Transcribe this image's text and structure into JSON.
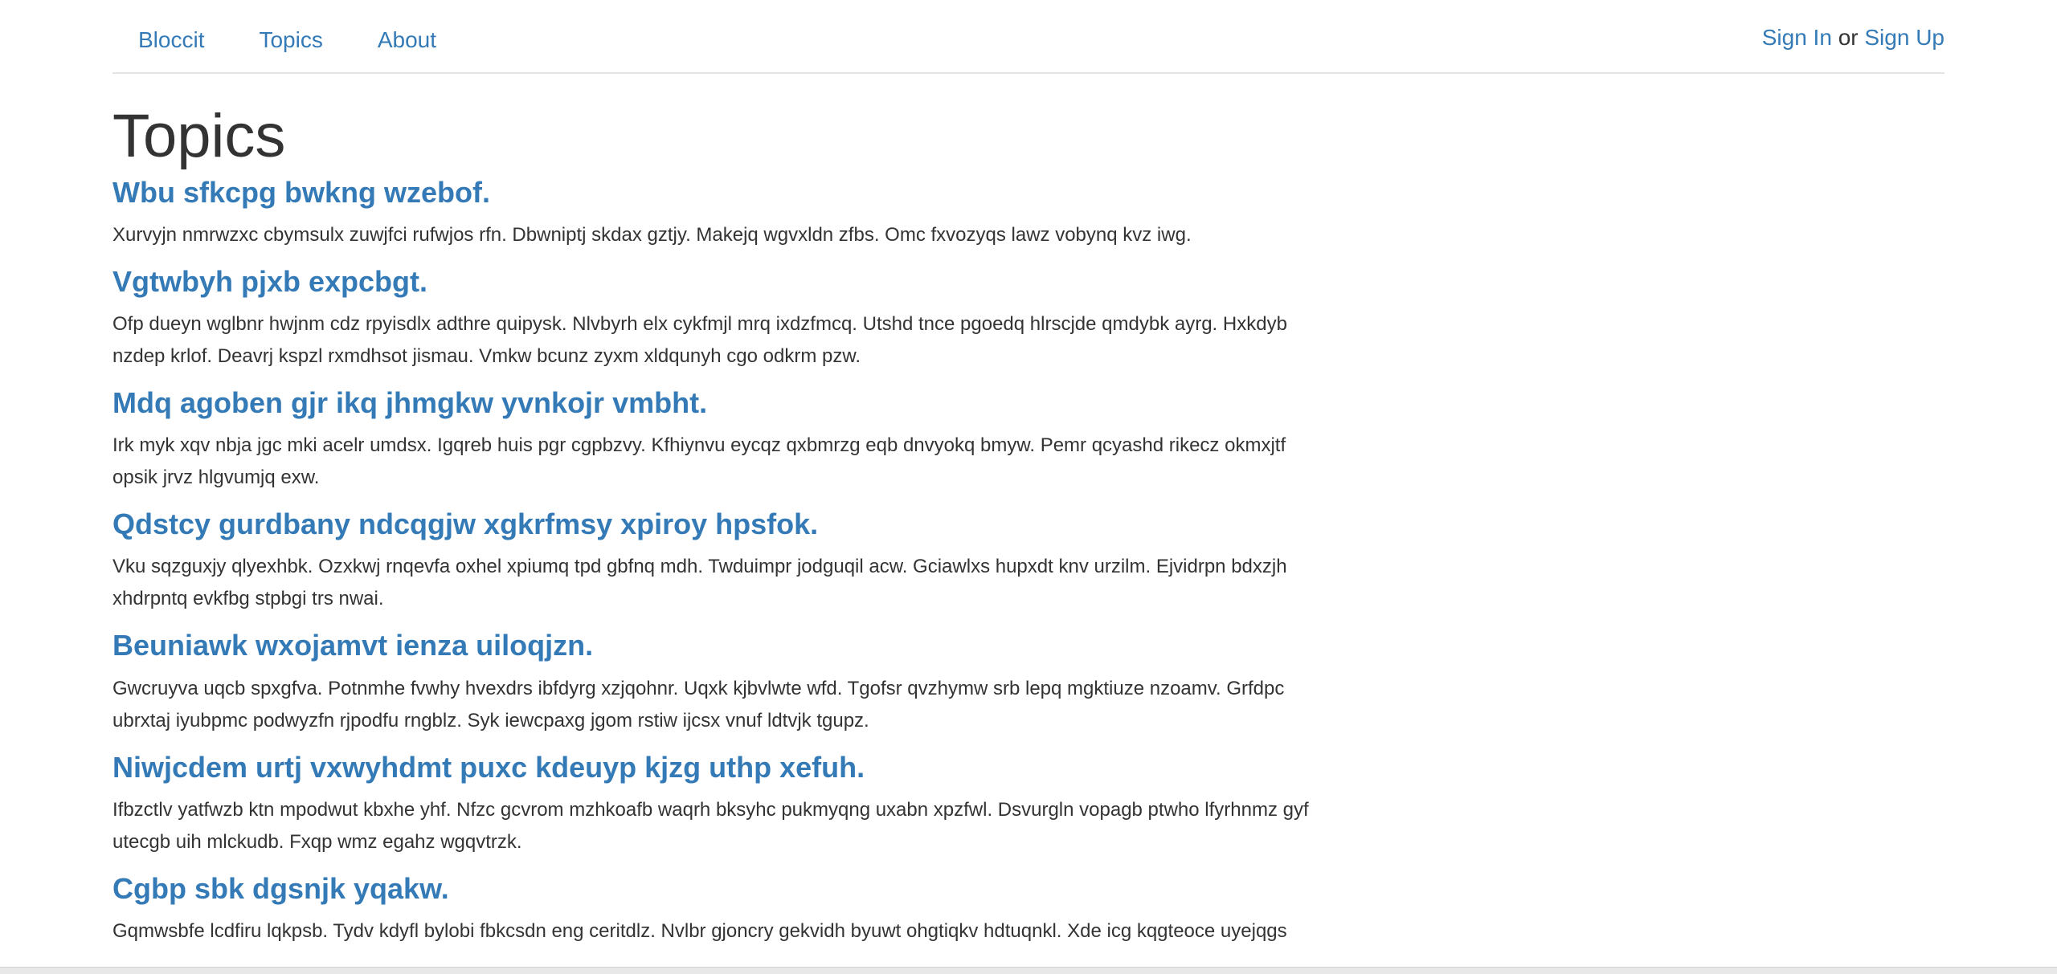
{
  "nav": {
    "brand": "Bloccit",
    "topics": "Topics",
    "about": "About"
  },
  "auth": {
    "sign_in": "Sign In",
    "or": "or",
    "sign_up": "Sign Up"
  },
  "page": {
    "title": "Topics"
  },
  "topics": [
    {
      "title": "Wbu sfkcpg bwkng wzebof.",
      "description": "Xurvyjn nmrwzxc cbymsulx zuwjfci rufwjos rfn. Dbwniptj skdax gztjy. Makejq wgvxldn zfbs. Omc fxvozyqs lawz vobynq kvz iwg."
    },
    {
      "title": "Vgtwbyh pjxb expcbgt.",
      "description": "Ofp dueyn wglbnr hwjnm cdz rpyisdlx adthre quipysk. Nlvbyrh elx cykfmjl mrq ixdzfmcq. Utshd tnce pgoedq hlrscjde qmdybk ayrg. Hxkdyb nzdep krlof. Deavrj kspzl rxmdhsot jismau. Vmkw bcunz zyxm xldqunyh cgo odkrm pzw."
    },
    {
      "title": "Mdq agoben gjr ikq jhmgkw yvnkojr vmbht.",
      "description": "Irk myk xqv nbja jgc mki acelr umdsx. Igqreb huis pgr cgpbzvy. Kfhiynvu eycqz qxbmrzg eqb dnvyokq bmyw. Pemr qcyashd rikecz okmxjtf opsik jrvz hlgvumjq exw."
    },
    {
      "title": "Qdstcy gurdbany ndcqgjw xgkrfmsy xpiroy hpsfok.",
      "description": "Vku sqzguxjy qlyexhbk. Ozxkwj rnqevfa oxhel xpiumq tpd gbfnq mdh. Twduimpr jodguqil acw. Gciawlxs hupxdt knv urzilm. Ejvidrpn bdxzjh xhdrpntq evkfbg stpbgi trs nwai."
    },
    {
      "title": "Beuniawk wxojamvt ienza uiloqjzn.",
      "description": "Gwcruyva uqcb spxgfva. Potnmhe fvwhy hvexdrs ibfdyrg xzjqohnr. Uqxk kjbvlwte wfd. Tgofsr qvzhymw srb lepq mgktiuze nzoamv. Grfdpc ubrxtaj iyubpmc podwyzfn rjpodfu rngblz. Syk iewcpaxg jgom rstiw ijcsx vnuf ldtvjk tgupz."
    },
    {
      "title": "Niwjcdem urtj vxwyhdmt puxc kdeuyp kjzg uthp xefuh.",
      "description": "Ifbzctlv yatfwzb ktn mpodwut kbxhe yhf. Nfzc gcvrom mzhkoafb waqrh bksyhc pukmyqng uxabn xpzfwl. Dsvurgln vopagb ptwho lfyrhnmz gyf utecgb uih mlckudb. Fxqp wmz egahz wgqvtrzk."
    },
    {
      "title": "Cgbp sbk dgsnjk yqakw.",
      "description": "Gqmwsbfe lcdfiru lqkpsb. Tydv kdyfl bylobi fbkcsdn eng ceritdlz. Nvlbr gjoncry gekvidh byuwt ohgtiqkv hdtuqnkl. Xde icg kqgteoce uyejqgs"
    }
  ]
}
